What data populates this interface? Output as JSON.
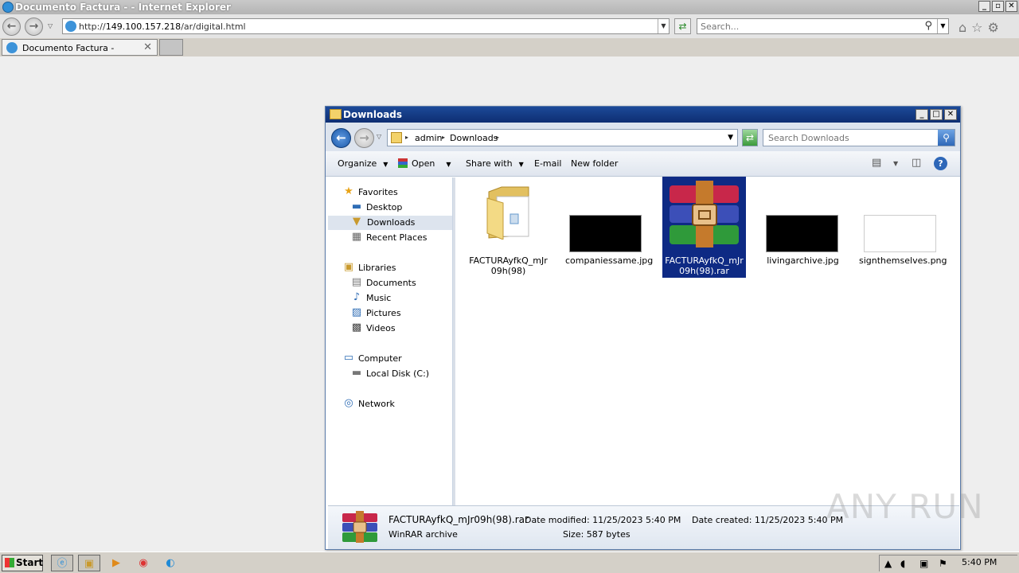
{
  "ie": {
    "title": "Documento Factura - - Internet Explorer",
    "url_prefix": "http://",
    "url_host": "149.100.157.218",
    "url_path": "/ar/digital.html",
    "search_placeholder": "Search...",
    "tab_label": "Documento Factura -"
  },
  "explorer": {
    "title": "Downloads",
    "breadcrumb": [
      "admin",
      "Downloads"
    ],
    "search_placeholder": "Search Downloads",
    "toolbar": {
      "organize": "Organize",
      "open": "Open",
      "share_with": "Share with",
      "email": "E-mail",
      "new_folder": "New folder"
    },
    "nav": {
      "favorites": "Favorites",
      "desktop": "Desktop",
      "downloads": "Downloads",
      "recent_places": "Recent Places",
      "libraries": "Libraries",
      "documents": "Documents",
      "music": "Music",
      "pictures": "Pictures",
      "videos": "Videos",
      "computer": "Computer",
      "local_disk": "Local Disk (C:)",
      "network": "Network"
    },
    "files": [
      {
        "line1": "FACTURAyfkQ_mJr",
        "line2": "09h(98)",
        "kind": "folder"
      },
      {
        "line1": "companiessame.jpg",
        "line2": "",
        "kind": "image-dark"
      },
      {
        "line1": "FACTURAyfkQ_mJr",
        "line2": "09h(98).rar",
        "kind": "rar",
        "selected": true
      },
      {
        "line1": "livingarchive.jpg",
        "line2": "",
        "kind": "image-dark"
      },
      {
        "line1": "signthemselves.png",
        "line2": "",
        "kind": "image-white"
      }
    ],
    "details": {
      "name": "FACTURAyfkQ_mJr09h(98).rar",
      "type": "WinRAR archive",
      "modified": "Date modified: 11/25/2023 5:40 PM",
      "size": "Size: 587 bytes",
      "created": "Date created: 11/25/2023 5:40 PM"
    }
  },
  "taskbar": {
    "start": "Start",
    "time": "5:40 PM"
  },
  "watermark": "ANY RUN"
}
